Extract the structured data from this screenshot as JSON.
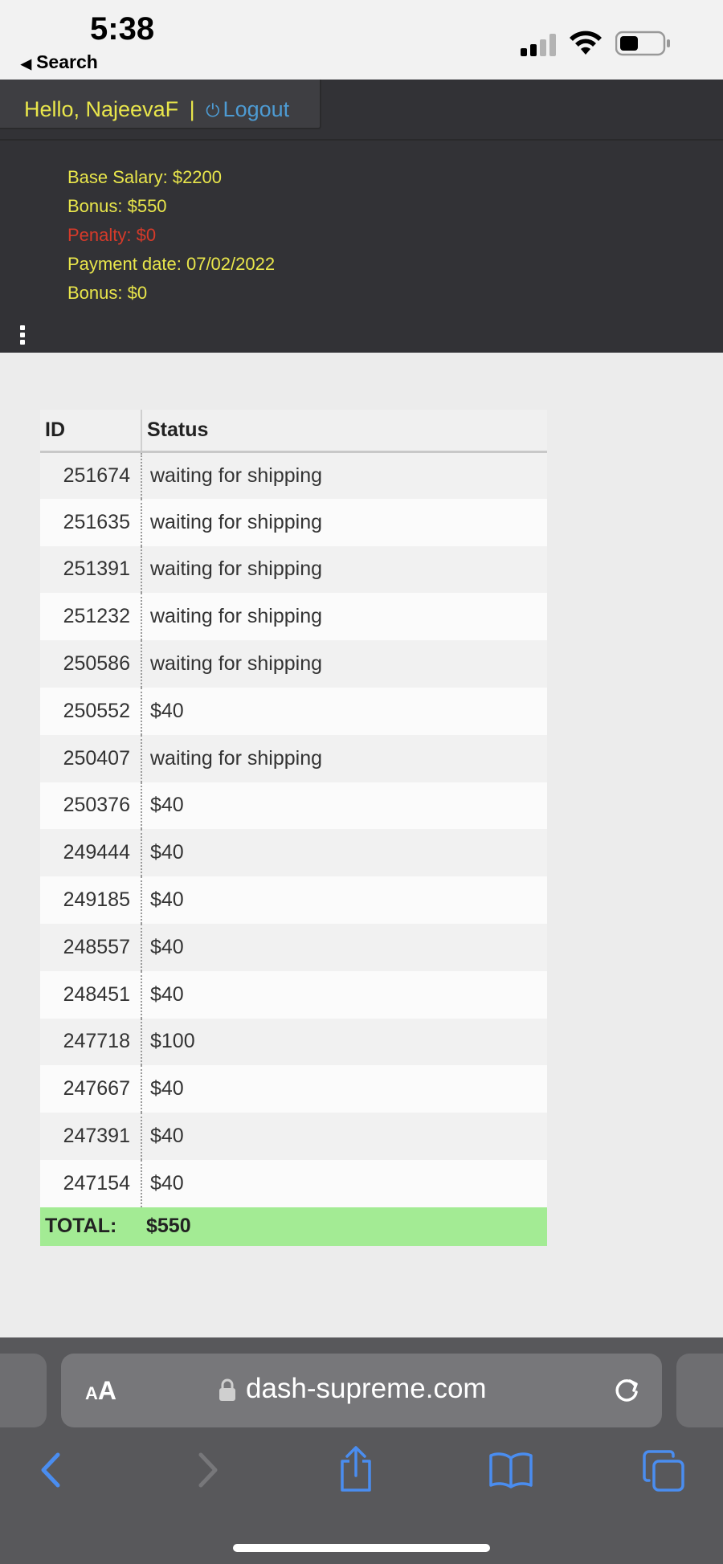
{
  "status_bar": {
    "time": "5:38",
    "back_label": "Search",
    "back_icon": "back-triangle-icon",
    "signal_bars_active": 2,
    "signal_bars_total": 4,
    "battery_level": 0.4
  },
  "header": {
    "greeting": "Hello, NajeevaF",
    "separator": "|",
    "logout_label": "Logout",
    "logout_icon": "power-icon",
    "colors": {
      "background": "#323236",
      "text": "#e9e64b",
      "penalty": "#d63a2a",
      "link": "#4d9bd3"
    },
    "info": {
      "base_salary": "Base Salary: $2200",
      "bonus": "Bonus: $550",
      "penalty": "Penalty: $0",
      "payment_date": "Payment date: 07/02/2022",
      "bonus_2": "Bonus: $0"
    },
    "menu_icon": "kebab-menu-icon"
  },
  "table": {
    "columns": [
      "ID",
      "Status"
    ],
    "rows": [
      {
        "id": "251674",
        "status": "waiting for shipping"
      },
      {
        "id": "251635",
        "status": "waiting for shipping"
      },
      {
        "id": "251391",
        "status": "waiting for shipping"
      },
      {
        "id": "251232",
        "status": "waiting for shipping"
      },
      {
        "id": "250586",
        "status": "waiting for shipping"
      },
      {
        "id": "250552",
        "status": "$40"
      },
      {
        "id": "250407",
        "status": "waiting for shipping"
      },
      {
        "id": "250376",
        "status": "$40"
      },
      {
        "id": "249444",
        "status": "$40"
      },
      {
        "id": "249185",
        "status": "$40"
      },
      {
        "id": "248557",
        "status": "$40"
      },
      {
        "id": "248451",
        "status": "$40"
      },
      {
        "id": "247718",
        "status": "$100"
      },
      {
        "id": "247667",
        "status": "$40"
      },
      {
        "id": "247391",
        "status": "$40"
      },
      {
        "id": "247154",
        "status": "$40"
      }
    ],
    "total_label": "TOTAL:",
    "total_value": "$550",
    "total_color": "#a3eb94"
  },
  "browser": {
    "text_size_label_small": "A",
    "text_size_label_big": "A",
    "url": "dash-supreme.com",
    "lock_icon": "lock-icon",
    "reload_icon": "reload-icon",
    "toolbar_icons": [
      "back-arrow-icon",
      "forward-arrow-icon",
      "share-icon",
      "bookmarks-icon",
      "tabs-icon"
    ]
  }
}
